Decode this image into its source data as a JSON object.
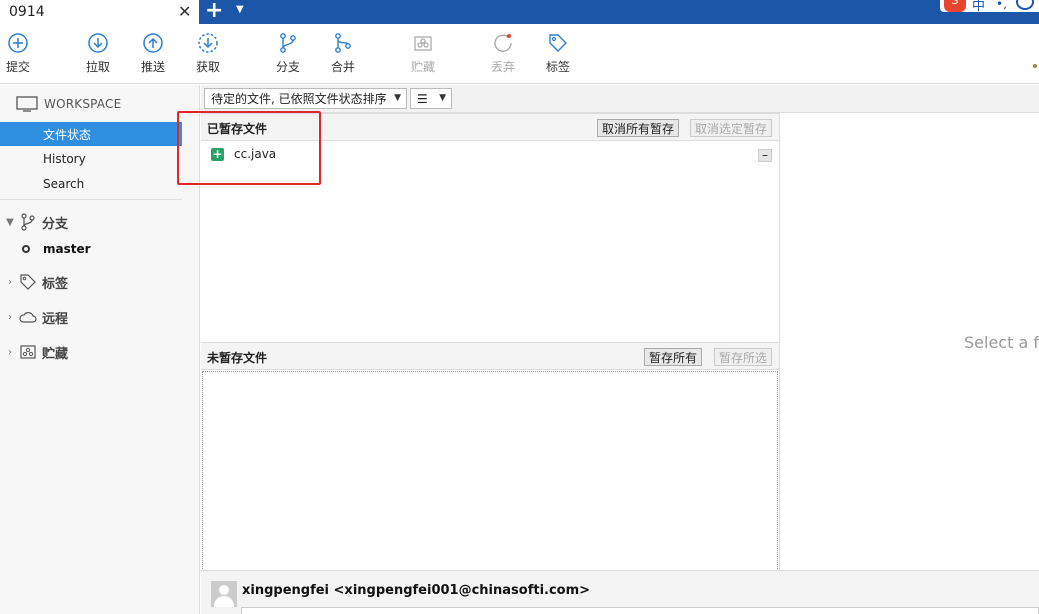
{
  "window": {
    "tab_title": "0914"
  },
  "toolbar": {
    "commit": "提交",
    "pull": "拉取",
    "push": "推送",
    "fetch": "获取",
    "branch": "分支",
    "merge": "合并",
    "stash": "贮藏",
    "discard": "丢弃",
    "tag": "标签"
  },
  "sidebar": {
    "workspace": "WORKSPACE",
    "items": [
      "文件状态",
      "History",
      "Search"
    ],
    "branches_label": "分支",
    "current_branch": "master",
    "tags_label": "标签",
    "remotes_label": "远程",
    "stashes_label": "贮藏"
  },
  "filter": {
    "sort_value": "待定的文件, 已依照文件状态排序"
  },
  "staged": {
    "title": "已暂存文件",
    "unstage_all": "取消所有暂存",
    "unstage_selected": "取消选定暂存",
    "files": [
      {
        "name": "cc.java",
        "status": "added"
      }
    ]
  },
  "unstaged": {
    "title": "未暂存文件",
    "stage_all": "暂存所有",
    "stage_selected": "暂存所选"
  },
  "diff": {
    "placeholder": "Select a fi"
  },
  "commit": {
    "author": "xingpengfei <xingpengfei001@chinasofti.com>"
  },
  "colors": {
    "accent": "#2e8fe0",
    "titlebar": "#1c56a8",
    "added": "#27a36a",
    "highlight": "#e2262b"
  }
}
